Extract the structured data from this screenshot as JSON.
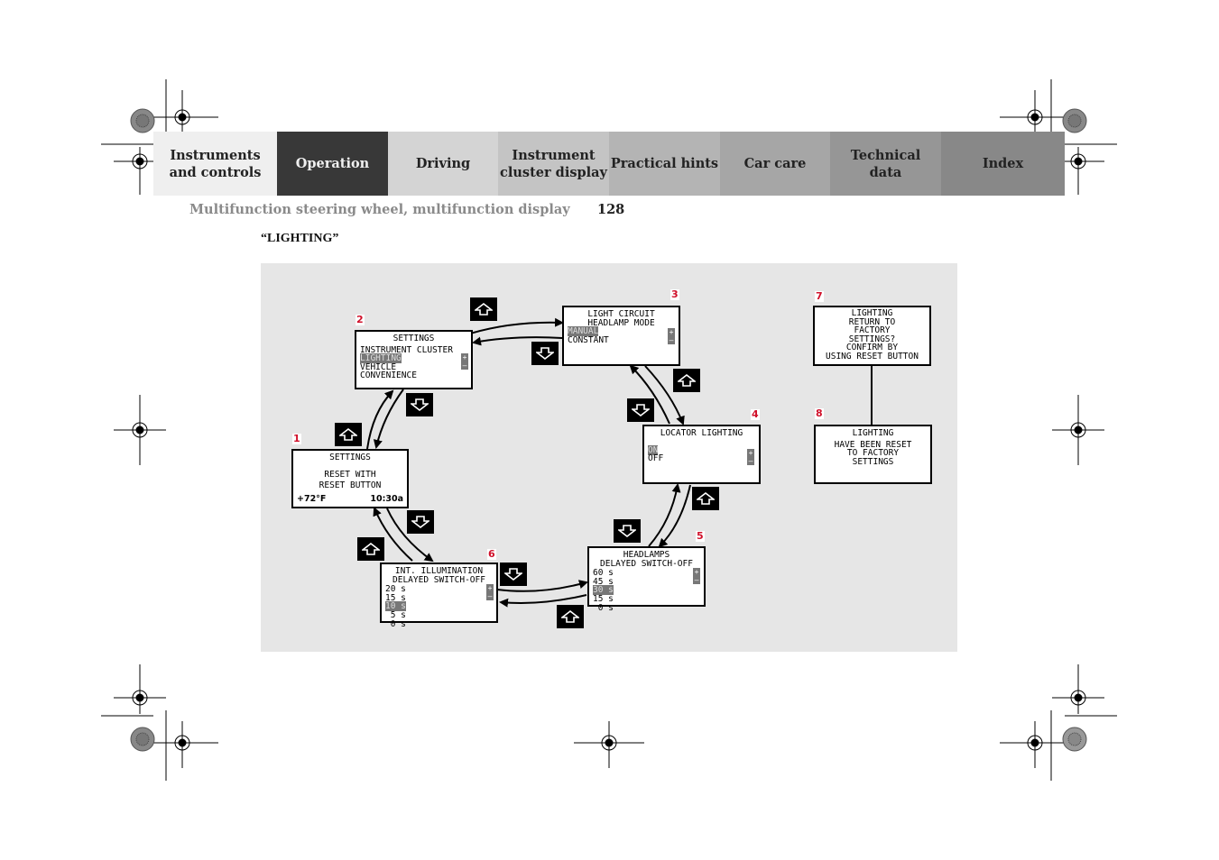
{
  "nav": {
    "tabs": [
      {
        "label_l1": "Instruments",
        "label_l2": "and controls",
        "bg": "#efefef",
        "color": "#222",
        "active": false
      },
      {
        "label_l1": "Operation",
        "label_l2": "",
        "bg": "#383838",
        "color": "#f0f0f0",
        "active": true
      },
      {
        "label_l1": "Driving",
        "label_l2": "",
        "bg": "#d4d4d4",
        "color": "#222",
        "active": false
      },
      {
        "label_l1": "Instrument",
        "label_l2": "cluster display",
        "bg": "#c4c4c4",
        "color": "#222",
        "active": false
      },
      {
        "label_l1": "Practical hints",
        "label_l2": "",
        "bg": "#b4b4b4",
        "color": "#222",
        "active": false
      },
      {
        "label_l1": "Car care",
        "label_l2": "",
        "bg": "#a6a6a6",
        "color": "#222",
        "active": false
      },
      {
        "label_l1": "Technical",
        "label_l2": "data",
        "bg": "#969696",
        "color": "#222",
        "active": false
      },
      {
        "label_l1": "Index",
        "label_l2": "",
        "bg": "#888888",
        "color": "#222",
        "active": false
      }
    ]
  },
  "header": {
    "subtitle": "Multifunction steering wheel, multifunction display",
    "page_number": "128"
  },
  "section": {
    "heading": "“LIGHTING”"
  },
  "diagram": {
    "step_color": "#d0102a",
    "screens": {
      "s1": {
        "num": "1",
        "title": "SETTINGS",
        "line1": "RESET WITH",
        "line2": "RESET BUTTON",
        "temp": "+72°F",
        "time": "10:30a"
      },
      "s2": {
        "num": "2",
        "title": "SETTINGS",
        "line1": "INSTRUMENT CLUSTER",
        "selected": "LIGHTING",
        "line3": "VEHICLE",
        "line4": "CONVENIENCE"
      },
      "s3": {
        "num": "3",
        "title1": "LIGHT CIRCUIT",
        "title2": "HEADLAMP MODE",
        "selected": "MANUAL",
        "line2": "CONSTANT"
      },
      "s4": {
        "num": "4",
        "title": "LOCATOR LIGHTING",
        "selected": "ON",
        "line2": "OFF"
      },
      "s5": {
        "num": "5",
        "title1": "HEADLAMPS",
        "title2": "DELAYED SWITCH-OFF",
        "o1": "60 s",
        "o2": "45 s",
        "selected": "30 s",
        "o4": "15 s",
        "o5": " 0 s"
      },
      "s6": {
        "num": "6",
        "title1": "INT. ILLUMINATION",
        "title2": "DELAYED SWITCH-OFF",
        "o1": "20 s",
        "o2": "15 s",
        "selected": "10 s",
        "o4": " 5 s",
        "o5": " 0 s"
      },
      "s7": {
        "num": "7",
        "l1": "LIGHTING",
        "l2": "RETURN TO",
        "l3": "FACTORY",
        "l4": "SETTINGS?",
        "l5": "CONFIRM BY",
        "l6": "USING RESET BUTTON"
      },
      "s8": {
        "num": "8",
        "l1": "LIGHTING",
        "l2": "HAVE BEEN RESET",
        "l3": "TO FACTORY",
        "l4": "SETTINGS"
      }
    },
    "plus": "+",
    "minus": "–",
    "icons": {
      "up": "up-arrow-button-icon",
      "down": "down-arrow-button-icon"
    }
  }
}
